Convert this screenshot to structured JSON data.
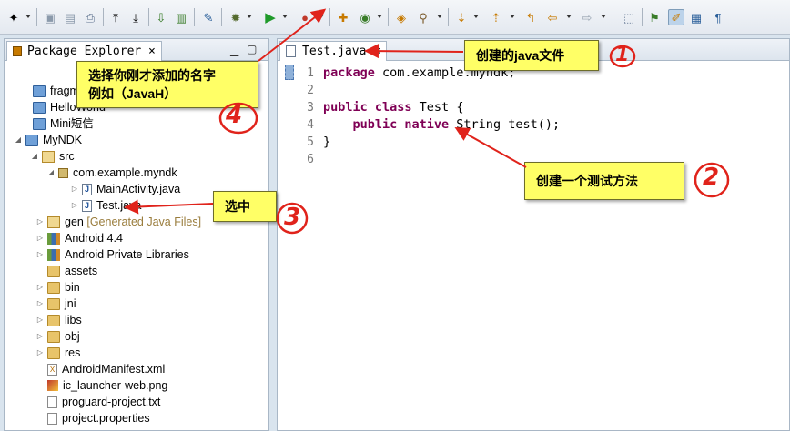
{
  "left_panel": {
    "tab_label": "Package Explorer ×",
    "items": [
      {
        "label": "fragm"
      },
      {
        "label": "HelloWorld"
      },
      {
        "label": "Mini短信"
      },
      {
        "label": "MyNDK"
      },
      {
        "label": "src"
      },
      {
        "label": "com.example.myndk"
      },
      {
        "label": "MainActivity.java"
      },
      {
        "label": "Test.java"
      },
      {
        "label": "gen",
        "suffix": "[Generated Java Files]"
      },
      {
        "label": "Android 4.4"
      },
      {
        "label": "Android Private Libraries"
      },
      {
        "label": "assets"
      },
      {
        "label": "bin"
      },
      {
        "label": "jni"
      },
      {
        "label": "libs"
      },
      {
        "label": "obj"
      },
      {
        "label": "res"
      },
      {
        "label": "AndroidManifest.xml"
      },
      {
        "label": "ic_launcher-web.png"
      },
      {
        "label": "proguard-project.txt"
      },
      {
        "label": "project.properties"
      }
    ]
  },
  "editor": {
    "tab_label": "Test.java ×",
    "line_numbers": [
      "1",
      "2",
      "3",
      "4",
      "5",
      "6"
    ],
    "lines": [
      {
        "kw1": "package",
        "rest": " com.example.myndk;"
      },
      {
        "kw1": "",
        "rest": ""
      },
      {
        "kw1": "public class",
        "rest": " Test {"
      },
      {
        "kw1": "    public native",
        "rest": " String test();"
      },
      {
        "kw1": "",
        "rest": "}"
      },
      {
        "kw1": "",
        "rest": ""
      }
    ]
  },
  "annotations": {
    "note1": "创建的java文件",
    "note2": "创建一个测试方法",
    "note3": "选中",
    "note4_line1": "选择你刚才添加的名字",
    "note4_line2": "例如（JavaH）",
    "num1": "1",
    "num2": "2",
    "num3": "3",
    "num4": "4"
  },
  "colors": {
    "keyword": "#7f0055",
    "annotation_bg": "#ffff66",
    "annotation_red": "#e0231b"
  }
}
